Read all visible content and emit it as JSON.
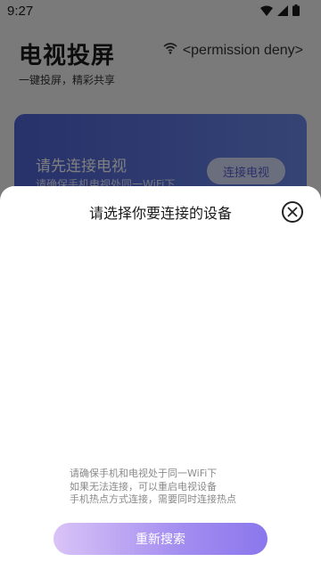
{
  "status_bar": {
    "time": "9:27",
    "icons": [
      "wifi-icon",
      "cellular-signal-icon",
      "battery-icon"
    ]
  },
  "header": {
    "title": "电视投屏",
    "subtitle": "一键投屏，精彩共享",
    "wifi_status": "<permission deny>"
  },
  "connect_card": {
    "title": "请先连接电视",
    "description": "请确保手机电视处同一WiFi下",
    "button_label": "连接电视"
  },
  "device_sheet": {
    "title": "请选择你要连接的设备",
    "tips": [
      "请确保手机和电视处于同一WiFi下",
      "如果无法连接，可以重启电视设备",
      "手机热点方式连接，需要同时连接热点"
    ],
    "retry_label": "重新搜索"
  },
  "colors": {
    "card_gradient_start": "#4f63d6",
    "card_gradient_end": "#6b88e8",
    "button_gradient_start": "#d9c3f7",
    "button_gradient_end": "#8a77ec"
  }
}
